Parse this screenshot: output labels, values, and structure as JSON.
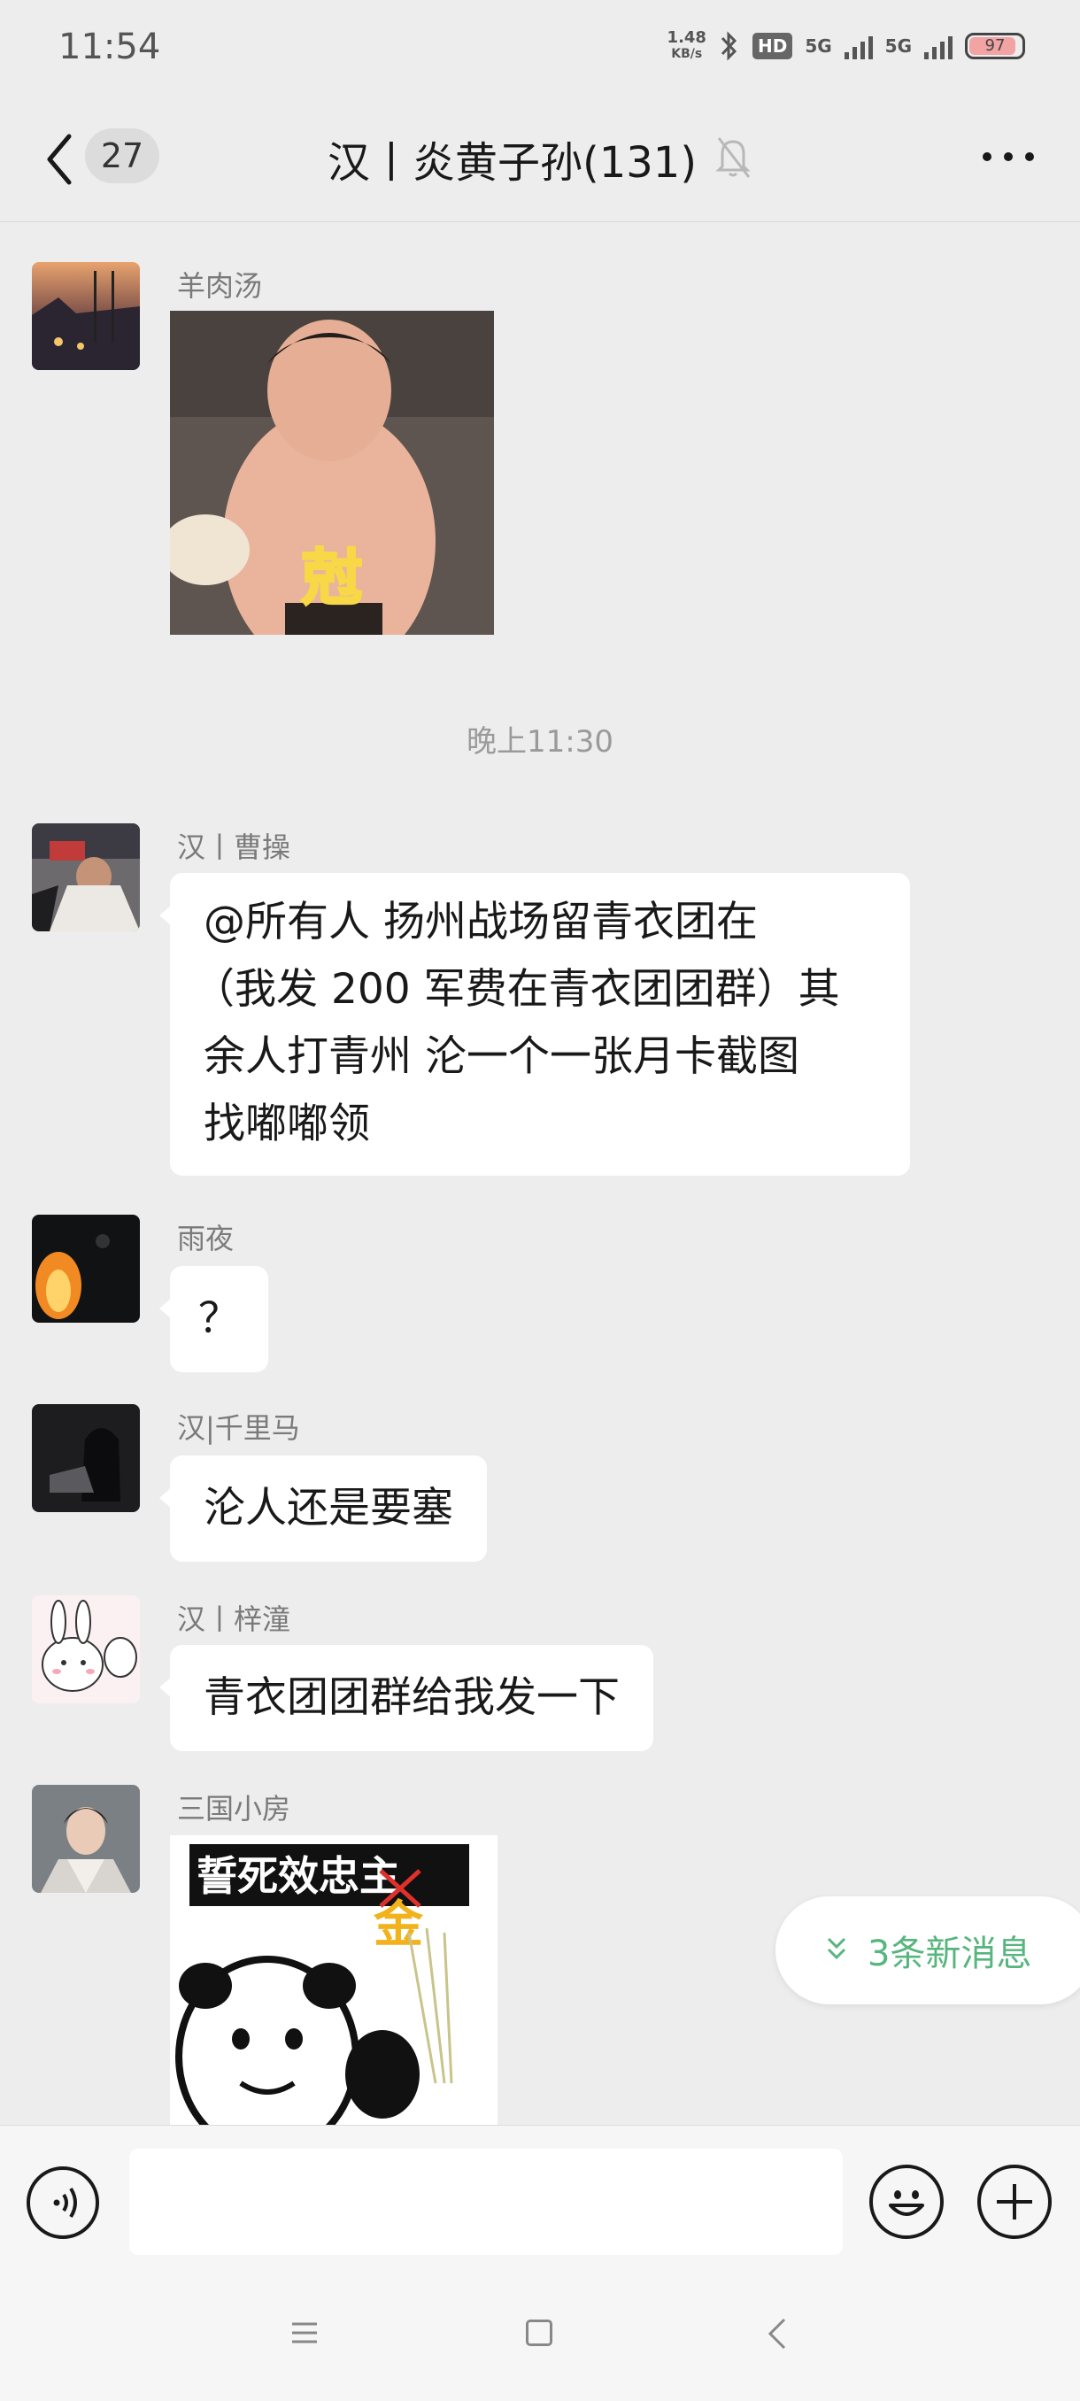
{
  "status_bar": {
    "time": "11:54",
    "net_speed": "1.48",
    "net_unit": "KB/s",
    "hd": "HD",
    "sim1": "5G",
    "sim2": "5G",
    "battery": "97"
  },
  "header": {
    "unread_count": "27",
    "title": "汉丨炎黄子孙(131)",
    "muted_icon": "bell-off-icon",
    "more_icon": "more-dots-icon"
  },
  "messages": [
    {
      "sender": "羊肉汤",
      "type": "sticker",
      "sticker_text": "尅"
    },
    {
      "type": "timestamp",
      "text": "晚上11:30"
    },
    {
      "sender": "汉丨曹操",
      "type": "text",
      "lines": [
        "@所有人  扬州战场留青衣团在",
        "（我发 200 军费在青衣团团群）其",
        "余人打青州 沦一个一张月卡截图",
        "找嘟嘟领"
      ]
    },
    {
      "sender": "雨夜",
      "type": "text",
      "text": "？"
    },
    {
      "sender": "汉|千里马",
      "type": "text",
      "text": "沦人还是要塞"
    },
    {
      "sender": "汉丨梓潼",
      "type": "text",
      "text": "青衣团团群给我发一下"
    },
    {
      "sender": "三国小房",
      "type": "sticker",
      "sticker_text": "誓死效忠主",
      "sticker_overlay": "金"
    }
  ],
  "new_messages_label": "3条新消息",
  "colors": {
    "background": "#ededed",
    "bubble": "#ffffff",
    "accent_green": "#57b57e"
  }
}
